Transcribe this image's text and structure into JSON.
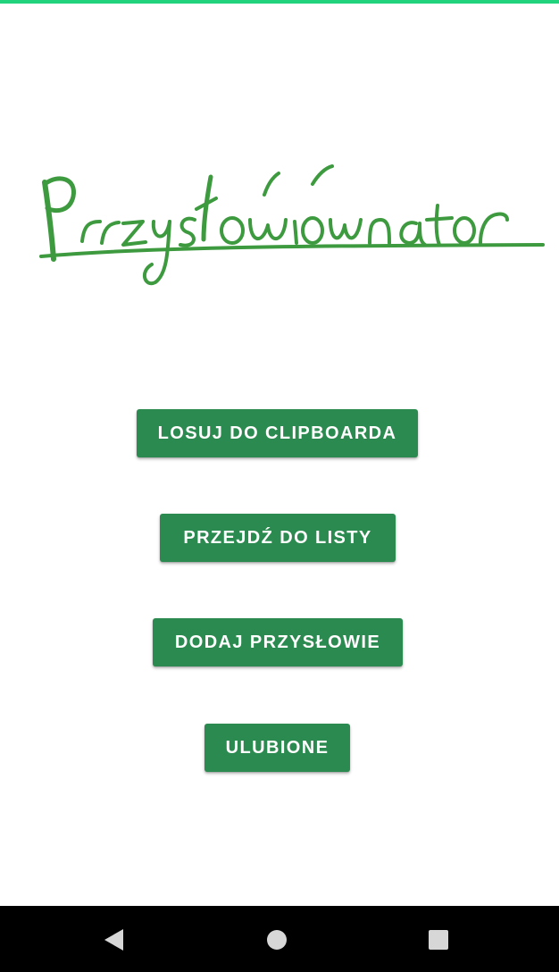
{
  "app": {
    "logo_text": "Przysłowiownator",
    "accent_color": "#2b8a4f",
    "logo_color": "#3d9a3f",
    "status_strip_color": "#22d37e"
  },
  "main": {
    "buttons": [
      {
        "label": "LOSUJ DO CLIPBOARDA"
      },
      {
        "label": "PRZEJDŹ DO LISTY"
      },
      {
        "label": "DODAJ PRZYSŁOWIE"
      },
      {
        "label": "ULUBIONE"
      }
    ]
  },
  "navigation": {
    "back_icon": "back-triangle-icon",
    "home_icon": "home-circle-icon",
    "recents_icon": "recents-square-icon"
  }
}
